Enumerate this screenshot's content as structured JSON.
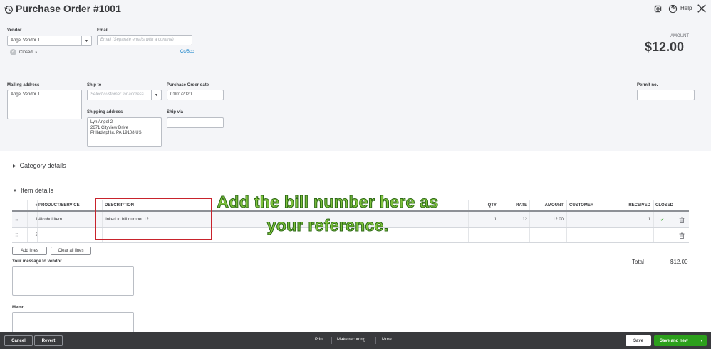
{
  "header": {
    "title": "Purchase Order #1001",
    "help_label": "Help"
  },
  "vendor": {
    "label": "Vendor",
    "value": "Angel Vendor 1",
    "status": "Closed"
  },
  "email": {
    "label": "Email",
    "placeholder": "Email (Separate emails with a comma)",
    "cc_bcc": "Cc/Bcc"
  },
  "amount": {
    "label": "AMOUNT",
    "value": "$12.00"
  },
  "mailing_address": {
    "label": "Mailing address",
    "value": "Angel Vendor 1"
  },
  "ship_to": {
    "label": "Ship to",
    "placeholder": "Select customer for address"
  },
  "po_date": {
    "label": "Purchase Order date",
    "value": "01/01/2020"
  },
  "permit": {
    "label": "Permit no.",
    "value": ""
  },
  "shipping_address": {
    "label": "Shipping address",
    "lines": [
      "Lyn Angel 2",
      "2671  Cityview Drive",
      "Philadelphia, PA  19108 US"
    ]
  },
  "ship_via": {
    "label": "Ship via",
    "value": ""
  },
  "sections": {
    "category": "Category details",
    "item": "Item details"
  },
  "table": {
    "headers": {
      "num": "#",
      "product": "PRODUCT/SERVICE",
      "description": "DESCRIPTION",
      "qty": "QTY",
      "rate": "RATE",
      "amount": "AMOUNT",
      "customer": "CUSTOMER",
      "received": "RECEIVED",
      "closed": "CLOSED"
    },
    "rows": [
      {
        "num": "1",
        "product": "Alcohol Item",
        "description": "linked to bill number 12",
        "qty": "1",
        "rate": "12",
        "amount": "12.00",
        "customer": "",
        "received": "1",
        "closed": "✔"
      },
      {
        "num": "2",
        "product": "",
        "description": "",
        "qty": "",
        "rate": "",
        "amount": "",
        "customer": "",
        "received": "",
        "closed": ""
      }
    ]
  },
  "buttons": {
    "add_lines": "Add lines",
    "clear_all_lines": "Clear all lines"
  },
  "message": {
    "label": "Your message to vendor"
  },
  "memo": {
    "label": "Memo"
  },
  "totals": {
    "label": "Total",
    "value": "$12.00"
  },
  "annotation": {
    "line1": "Add the bill number here as",
    "line2": "your reference."
  },
  "footer": {
    "cancel": "Cancel",
    "revert": "Revert",
    "print": "Print",
    "make_recurring": "Make recurring",
    "more": "More",
    "save": "Save",
    "save_and_new": "Save and new"
  },
  "colors": {
    "accent_green": "#2ca01c",
    "annotation_red": "#c8232c",
    "annotation_text": "#7ec13c",
    "footer_bg": "#393a3d",
    "link": "#0077c5"
  }
}
